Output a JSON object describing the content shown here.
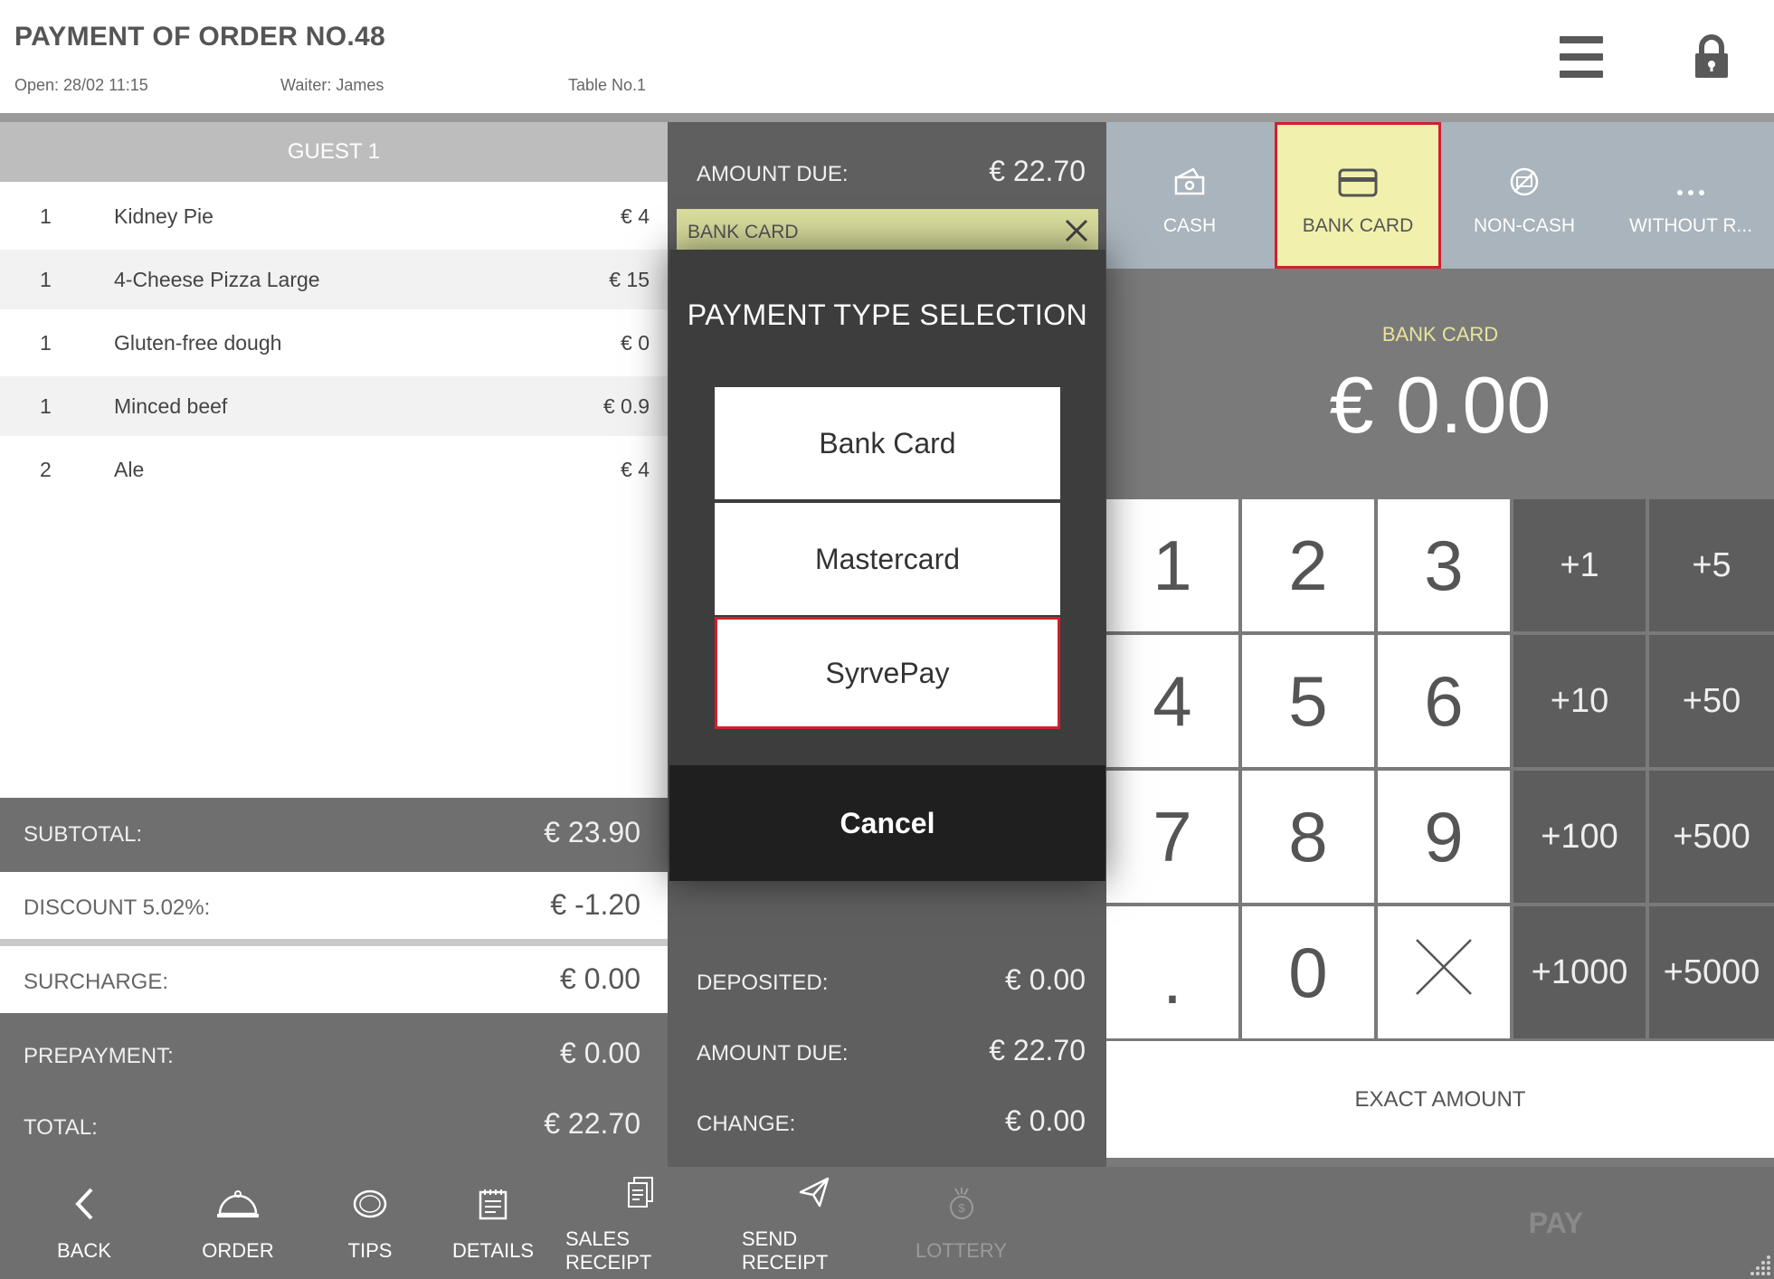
{
  "header": {
    "title": "PAYMENT OF ORDER NO.48",
    "open": "Open: 28/02 11:15",
    "waiter": "Waiter: James",
    "table": "Table No.1"
  },
  "order": {
    "guest_label": "GUEST 1",
    "items": [
      {
        "qty": "1",
        "name": "Kidney Pie",
        "price": "€ 4"
      },
      {
        "qty": "1",
        "name": "4-Cheese Pizza Large",
        "price": "€ 15"
      },
      {
        "qty": "1",
        "name": "Gluten-free dough",
        "price": "€ 0"
      },
      {
        "qty": "1",
        "name": "Minced beef",
        "price": "€ 0.9"
      },
      {
        "qty": "2",
        "name": "Ale",
        "price": "€ 4"
      }
    ]
  },
  "summary": {
    "subtotal_label": "SUBTOTAL:",
    "subtotal": "€ 23.90",
    "discount_label": "DISCOUNT 5.02%:",
    "discount": "€ -1.20",
    "surcharge_label": "SURCHARGE:",
    "surcharge": "€ 0.00",
    "prepayment_label": "PREPAYMENT:",
    "prepayment": "€ 0.00",
    "total_label": "TOTAL:",
    "total": "€ 22.70"
  },
  "middle": {
    "amount_due_label": "AMOUNT DUE:",
    "amount_due": "€ 22.70",
    "selected_payment": "BANK CARD",
    "deposited_label": "DEPOSITED:",
    "deposited": "€ 0.00",
    "amount_due2_label": "AMOUNT DUE:",
    "amount_due2": "€ 22.70",
    "change_label": "CHANGE:",
    "change": "€ 0.00"
  },
  "payment_tabs": [
    {
      "label": "CASH",
      "icon": "cash-icon"
    },
    {
      "label": "BANK CARD",
      "icon": "card-icon"
    },
    {
      "label": "NON-CASH",
      "icon": "non-cash-icon"
    },
    {
      "label": "WITHOUT R...",
      "icon": "more-icon"
    }
  ],
  "display": {
    "label": "BANK CARD",
    "amount": "€ 0.00"
  },
  "keypad": {
    "digits": [
      "1",
      "2",
      "3",
      "4",
      "5",
      "6",
      "7",
      "8",
      "9",
      ".",
      "0"
    ],
    "quick": [
      "+1",
      "+5",
      "+10",
      "+50",
      "+100",
      "+500",
      "+1000",
      "+5000"
    ],
    "exact_label": "EXACT AMOUNT"
  },
  "modal": {
    "title": "PAYMENT TYPE SELECTION",
    "options": [
      "Bank Card",
      "Mastercard",
      "SyrvePay"
    ],
    "cancel": "Cancel"
  },
  "bottom": {
    "back": "BACK",
    "order": "ORDER",
    "tips": "TIPS",
    "details": "DETAILS",
    "sales_receipt": "SALES RECEIPT",
    "send_receipt": "SEND RECEIPT",
    "lottery": "LOTTERY",
    "pay": "PAY"
  },
  "colors": {
    "selected_tab": "#f1f1ad",
    "selection_border": "#d21f2f",
    "modal_bg": "#3d3d3d",
    "accent_label": "#e8e49a"
  }
}
